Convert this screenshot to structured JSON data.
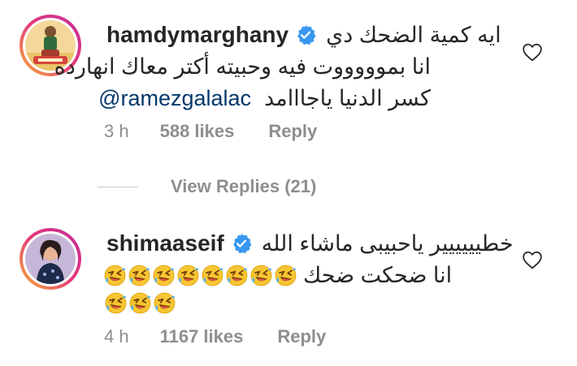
{
  "comments": [
    {
      "username": "hamdymarghany",
      "text_lines": [
        "ايه كمية الضحك دي",
        "انا بموووووت فيه وحبيته أكتر معاك انهارده",
        "كسر الدنيا ياجااامد"
      ],
      "mention": "@ramezgalalac",
      "time": "3 h",
      "likes": "588 likes",
      "reply": "Reply"
    },
    {
      "username": "shimaaseif",
      "text_lines": [
        "خطيييييير ياحبيبى ماشاء الله",
        "انا ضحكت ضحك"
      ],
      "time": "4 h",
      "likes": "1167 likes",
      "reply": "Reply"
    }
  ],
  "view_replies": "View Replies (21)",
  "icons": {
    "verified": "verified-badge-icon",
    "heart": "heart-outline-icon",
    "emoji": "rolling-on-floor-laughing-emoji"
  },
  "colors": {
    "verified": "#3897f0",
    "secondary_text": "#8e8e8e",
    "mention": "#00376b",
    "emoji_face": "#f7c531"
  }
}
